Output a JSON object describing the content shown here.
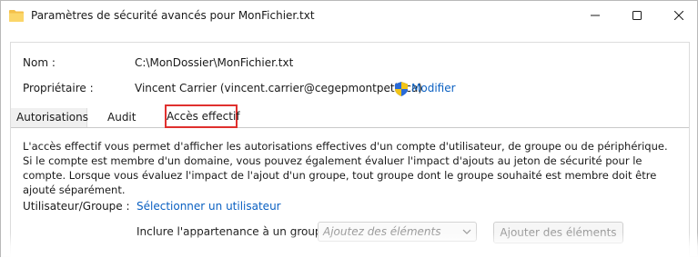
{
  "window": {
    "title": "Paramètres de sécurité avancés pour MonFichier.txt"
  },
  "fields": {
    "name_label": "Nom :",
    "name_value": "C:\\MonDossier\\MonFichier.txt",
    "owner_label": "Propriétaire :",
    "owner_value": "Vincent Carrier (vincent.carrier@cegepmontpetit.ca)",
    "modify_link": "Modifier"
  },
  "tabs": [
    {
      "label": "Autorisations"
    },
    {
      "label": "Audit"
    },
    {
      "label": "Accès effectif",
      "selected": true
    }
  ],
  "description": "L'accès effectif vous permet d'afficher les autorisations effectives d'un compte d'utilisateur, de groupe ou de périphérique. Si le compte est membre d'un domaine, vous pouvez également évaluer l'impact d'ajouts au jeton de sécurité pour le compte. Lorsque vous évaluez l'impact de l'ajout d'un groupe, tout groupe dont le groupe souhaité est membre doit être ajouté séparément.",
  "user_group": {
    "label": "Utilisateur/Groupe :",
    "select_link": "Sélectionner un utilisateur"
  },
  "include": {
    "label": "Inclure l'appartenance à un group",
    "combo_placeholder": "Ajoutez des éléments",
    "add_button": "Ajouter des éléments"
  },
  "colors": {
    "link": "#0a60c2",
    "highlight": "#e0302e",
    "folder": "#f4c04a"
  },
  "icons": {
    "title": "folder-icon",
    "minimize": "minimize-icon",
    "maximize": "maximize-icon",
    "close": "close-icon",
    "modify": "uac-shield-icon",
    "combo": "chevron-down-icon"
  }
}
